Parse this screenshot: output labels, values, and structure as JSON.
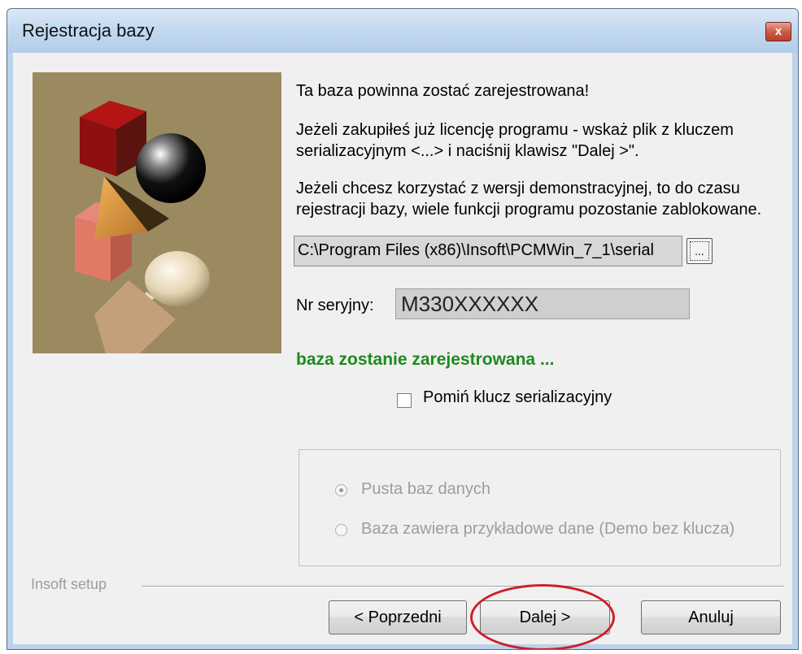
{
  "window": {
    "title": "Rejestracja bazy",
    "close_symbol": "x"
  },
  "info": {
    "line1": "Ta baza powinna zostać zarejestrowana!",
    "line2a": "Jeżeli zakupiłeś już licencję programu - wskaż plik z kluczem",
    "line2b": "serializacyjnym <...> i naciśnij klawisz \"Dalej >\".",
    "line3a": "Jeżeli chcesz korzystać z wersji demonstracyjnej, to do czasu",
    "line3b": "rejestracji bazy, wiele funkcji programu pozostanie zablokowane."
  },
  "path_field": {
    "value": "C:\\Program Files (x86)\\Insoft\\PCMWin_7_1\\serial"
  },
  "browse_button": {
    "label": "..."
  },
  "serial": {
    "label": "Nr seryjny:",
    "value": "M330XXXXXX"
  },
  "status": {
    "text": "baza zostanie zarejestrowana ...",
    "color": "#1e8a1e"
  },
  "skip_key": {
    "label": "Pomiń klucz serializacyjny",
    "checked": false
  },
  "database_options": {
    "enabled": false,
    "selected": "empty",
    "options": [
      {
        "label": "Pusta baz danych"
      },
      {
        "label": "Baza zawiera przykładowe dane (Demo bez klucza)"
      }
    ]
  },
  "footer": {
    "separator_label": "Insoft setup"
  },
  "buttons": {
    "back": "< Poprzedni",
    "next": "Dalej >",
    "cancel": "Anuluj"
  },
  "annotation": {
    "highlight_color": "#cc1f2b"
  },
  "icons": {
    "close": "close-icon",
    "browse": "folder-browse-icon"
  }
}
